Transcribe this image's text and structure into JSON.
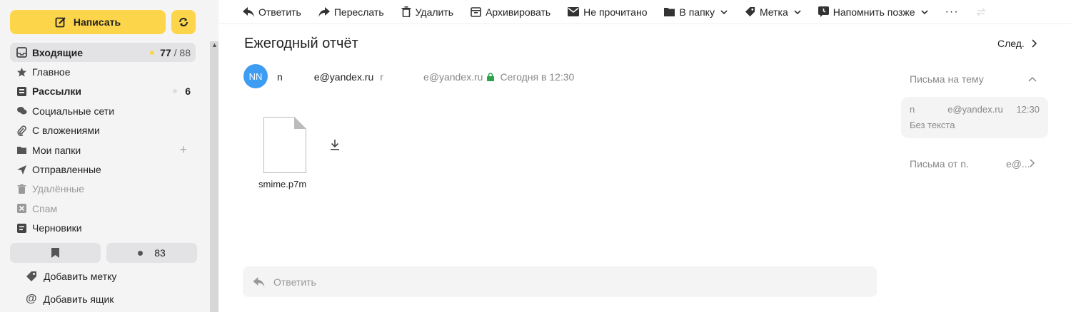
{
  "sidebar": {
    "compose_label": "Написать",
    "folders": [
      {
        "label": "Входящие",
        "count": "77",
        "total": "/ 88",
        "icon": "inbox-icon"
      },
      {
        "label": "Главное",
        "icon": "star-icon"
      },
      {
        "label": "Рассылки",
        "count": "6",
        "icon": "newsletter-icon"
      },
      {
        "label": "Социальные сети",
        "icon": "chat-icon"
      },
      {
        "label": "С вложениями",
        "icon": "paperclip-icon"
      },
      {
        "label": "Мои папки",
        "icon": "folder-icon"
      },
      {
        "label": "Отправленные",
        "icon": "send-icon"
      },
      {
        "label": "Удалённые",
        "icon": "trash-icon"
      },
      {
        "label": "Спам",
        "icon": "spam-icon"
      },
      {
        "label": "Черновики",
        "icon": "drafts-icon"
      }
    ],
    "unread_chip_count": "83",
    "add_label": "Добавить метку",
    "add_mailbox": "Добавить ящик"
  },
  "toolbar": {
    "reply": "Ответить",
    "forward": "Переслать",
    "delete": "Удалить",
    "archive": "Архивировать",
    "unread": "Не прочитано",
    "to_folder": "В папку",
    "label": "Метка",
    "remind": "Напомнить позже",
    "more": "···"
  },
  "message": {
    "subject": "Ежегодный отчёт",
    "next": "След.",
    "avatar_initials": "NN",
    "from_prefix": "n",
    "from_suffix": "e@yandex.ru",
    "to_prefix": "r",
    "to_suffix": "e@yandex.ru",
    "date": "Сегодня в 12:30",
    "attachment_name": "smime.p7m"
  },
  "reply_box": {
    "placeholder": "Ответить"
  },
  "thread": {
    "header": "Письма на тему",
    "item_from_prefix": "n",
    "item_from_suffix": "e@yandex.ru",
    "item_time": "12:30",
    "item_body": "Без текста",
    "from_link_prefix": "Письма от n.",
    "from_link_suffix": "e@..."
  },
  "colors": {
    "accent": "#fdd54a",
    "avatar": "#3d9df2",
    "unread_dot": "#fdd54a",
    "lock": "#2aa34a"
  }
}
